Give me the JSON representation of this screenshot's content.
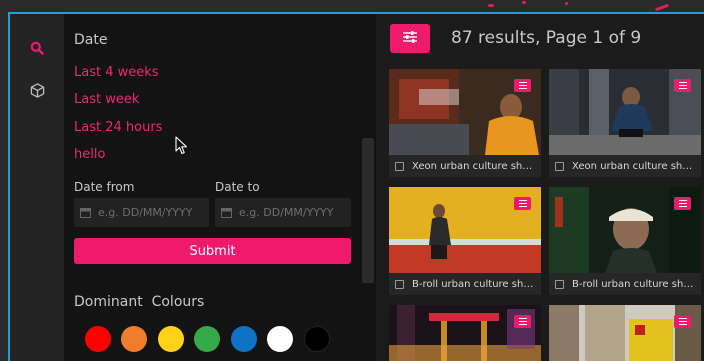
{
  "sidebar": {
    "items": [
      {
        "icon": "search-icon",
        "color": "#f01a6c"
      },
      {
        "icon": "cube-icon",
        "color": "#bdbdbd"
      }
    ]
  },
  "filters": {
    "date_section_title": "Date",
    "date_options": [
      "Last 4 weeks",
      "Last week",
      "Last 24 hours",
      "hello"
    ],
    "date_from_label": "Date from",
    "date_to_label": "Date to",
    "date_from_placeholder": "e.g. DD/MM/YYYY",
    "date_to_placeholder": "e.g. DD/MM/YYYY",
    "submit_label": "Submit",
    "colours_title": "Dominant  Colours",
    "colour_swatches": [
      "#ff0000",
      "#ef7d2b",
      "#ffd21a",
      "#35a84a",
      "#0f72c4",
      "#ffffff",
      "#000000"
    ]
  },
  "results": {
    "summary": "87 results, Page 1 of 9",
    "cards": [
      {
        "caption": "Xeon urban culture shooting"
      },
      {
        "caption": "Xeon urban culture shooting"
      },
      {
        "caption": "B-roll urban culture shooting"
      },
      {
        "caption": "B-roll urban culture shooting"
      },
      {
        "caption": ""
      },
      {
        "caption": ""
      }
    ]
  },
  "theme": {
    "accent": "#f01a6c",
    "frame": "#1ba3d8"
  }
}
